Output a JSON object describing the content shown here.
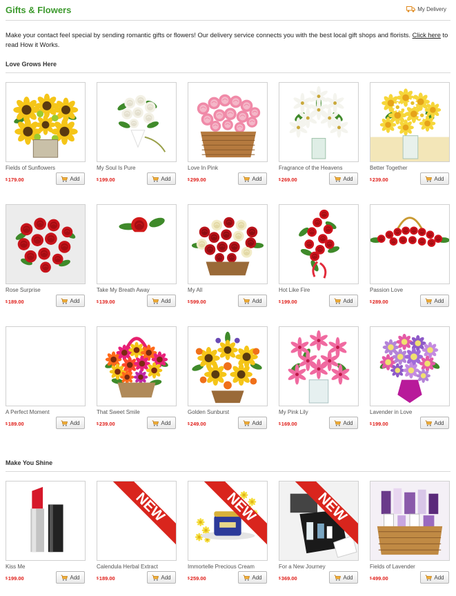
{
  "header": {
    "title": "Gifts & Flowers",
    "my_delivery": "My Delivery",
    "my_delivery_icon": "truck-icon"
  },
  "intro": {
    "text": "Make your contact feel special by sending romantic gifts or flowers! Our delivery service connects you with the best local gift shops and florists. ",
    "link": "Click here",
    "text_after": " to read How it Works."
  },
  "currency_symbol": "$",
  "add_label": "Add",
  "new_badge": "NEW",
  "colors": {
    "title_green": "#3d9a2e",
    "price_red": "#e0201b",
    "ribbon_red": "#d9251d"
  },
  "sections": [
    {
      "title": "Love Grows Here",
      "products": [
        {
          "name": "Fields of Sunflowers",
          "price": "179.00",
          "image": "sunflower-bouquet"
        },
        {
          "name": "My Soul Is Pure",
          "price": "199.00",
          "image": "white-rose-bouquet"
        },
        {
          "name": "Love In Pink",
          "price": "299.00",
          "image": "pink-rose-basket"
        },
        {
          "name": "Fragrance of the Heavens",
          "price": "269.00",
          "image": "white-lily-vase"
        },
        {
          "name": "Better Together",
          "price": "239.00",
          "image": "yellow-daisy-vase"
        },
        {
          "name": "Rose Surprise",
          "price": "189.00",
          "image": "red-rose-bouquet"
        },
        {
          "name": "Take My Breath Away",
          "price": "139.00",
          "image": "single-red-rose"
        },
        {
          "name": "My All",
          "price": "599.00",
          "image": "red-white-rose-basket"
        },
        {
          "name": "Hot Like Fire",
          "price": "199.00",
          "image": "red-rose-spray"
        },
        {
          "name": "Passion Love",
          "price": "289.00",
          "image": "red-rose-handle-basket"
        },
        {
          "name": "A Perfect Moment",
          "price": "189.00",
          "image": "blank"
        },
        {
          "name": "That Sweet Smile",
          "price": "239.00",
          "image": "colorful-basket"
        },
        {
          "name": "Golden Sunburst",
          "price": "249.00",
          "image": "sunflower-arrangement"
        },
        {
          "name": "My Pink Lily",
          "price": "169.00",
          "image": "pink-lily-vase"
        },
        {
          "name": "Lavender in Love",
          "price": "199.00",
          "image": "lavender-vase"
        }
      ]
    },
    {
      "title": "Make You Shine",
      "products": [
        {
          "name": "Kiss Me",
          "price": "199.00",
          "image": "lipstick",
          "is_new": false
        },
        {
          "name": "Calendula Herbal Extract",
          "price": "189.00",
          "image": "blank",
          "is_new": true
        },
        {
          "name": "Immortelle Precious Cream",
          "price": "259.00",
          "image": "cream-jar",
          "is_new": true
        },
        {
          "name": "For a New Journey",
          "price": "369.00",
          "image": "travel-kit",
          "is_new": true
        },
        {
          "name": "Fields of Lavender",
          "price": "499.00",
          "image": "gift-basket",
          "is_new": false
        }
      ]
    }
  ]
}
